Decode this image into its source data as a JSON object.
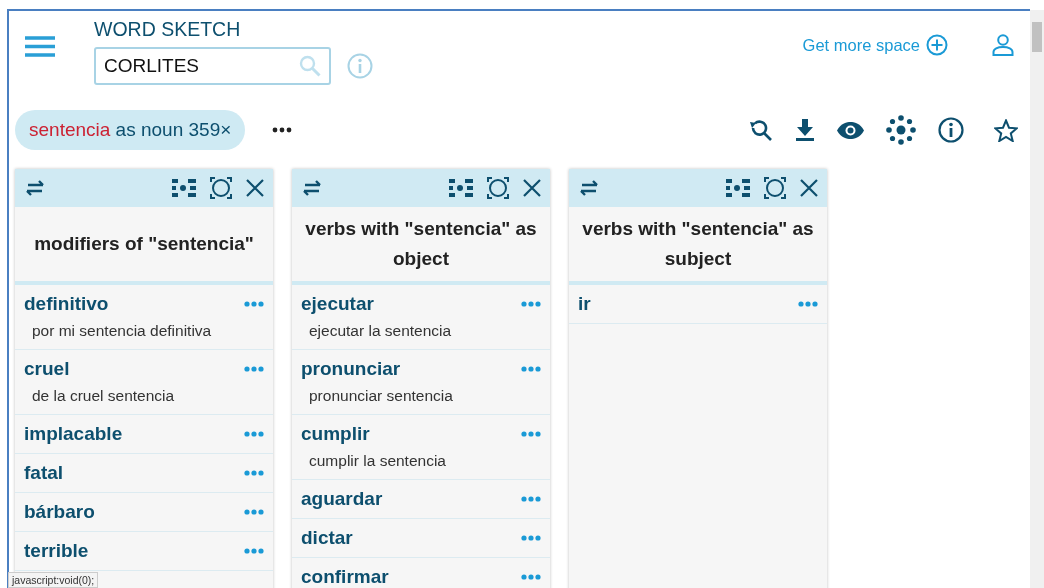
{
  "app": {
    "title": "WORD SKETCH"
  },
  "search": {
    "value": "CORLITES"
  },
  "header_link": "Get more space",
  "query_chip": {
    "lemma": "sentencia",
    "rest": "as noun 359×"
  },
  "columns": [
    {
      "title": "modifiers of \"sentencia\"",
      "rows": [
        {
          "word": "definitivo",
          "example": "por mi sentencia definitiva"
        },
        {
          "word": "cruel",
          "example": "de la cruel sentencia"
        },
        {
          "word": "implacable"
        },
        {
          "word": "fatal"
        },
        {
          "word": "bárbaro"
        },
        {
          "word": "terrible"
        }
      ]
    },
    {
      "title": "verbs with \"sentencia\" as object",
      "rows": [
        {
          "word": "ejecutar",
          "example": "ejecutar la sentencia"
        },
        {
          "word": "pronunciar",
          "example": "pronunciar sentencia"
        },
        {
          "word": "cumplir",
          "example": "cumplir la sentencia"
        },
        {
          "word": "aguardar"
        },
        {
          "word": "dictar"
        },
        {
          "word": "confirmar"
        }
      ]
    },
    {
      "title": "verbs with \"sentencia\" as subject",
      "rows": [
        {
          "word": "ir"
        }
      ]
    }
  ],
  "status_bar": "javascript:void(0);"
}
